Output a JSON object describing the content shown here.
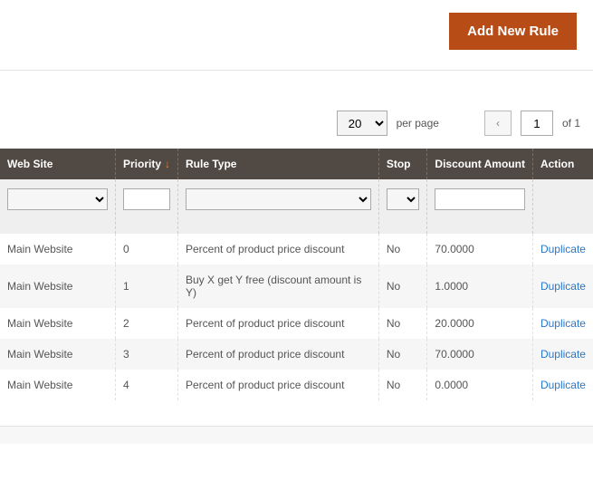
{
  "toolbar": {
    "add_new_rule": "Add New Rule"
  },
  "pager": {
    "page_size": "20",
    "per_page_label": "per page",
    "current_page": "1",
    "of_label": "of",
    "total_pages": "1"
  },
  "table": {
    "headers": {
      "website": "Web Site",
      "priority": "Priority",
      "rule_type": "Rule Type",
      "stop": "Stop",
      "discount": "Discount Amount",
      "action": "Action"
    },
    "action_label": "Duplicate",
    "rows": [
      {
        "website": "Main Website",
        "priority": "0",
        "rule_type": "Percent of product price discount",
        "stop": "No",
        "discount": "70.0000"
      },
      {
        "website": "Main Website",
        "priority": "1",
        "rule_type": "Buy X get Y free (discount amount is Y)",
        "stop": "No",
        "discount": "1.0000"
      },
      {
        "website": "Main Website",
        "priority": "2",
        "rule_type": "Percent of product price discount",
        "stop": "No",
        "discount": "20.0000"
      },
      {
        "website": "Main Website",
        "priority": "3",
        "rule_type": "Percent of product price discount",
        "stop": "No",
        "discount": "70.0000"
      },
      {
        "website": "Main Website",
        "priority": "4",
        "rule_type": "Percent of product price discount",
        "stop": "No",
        "discount": "0.0000"
      }
    ]
  }
}
